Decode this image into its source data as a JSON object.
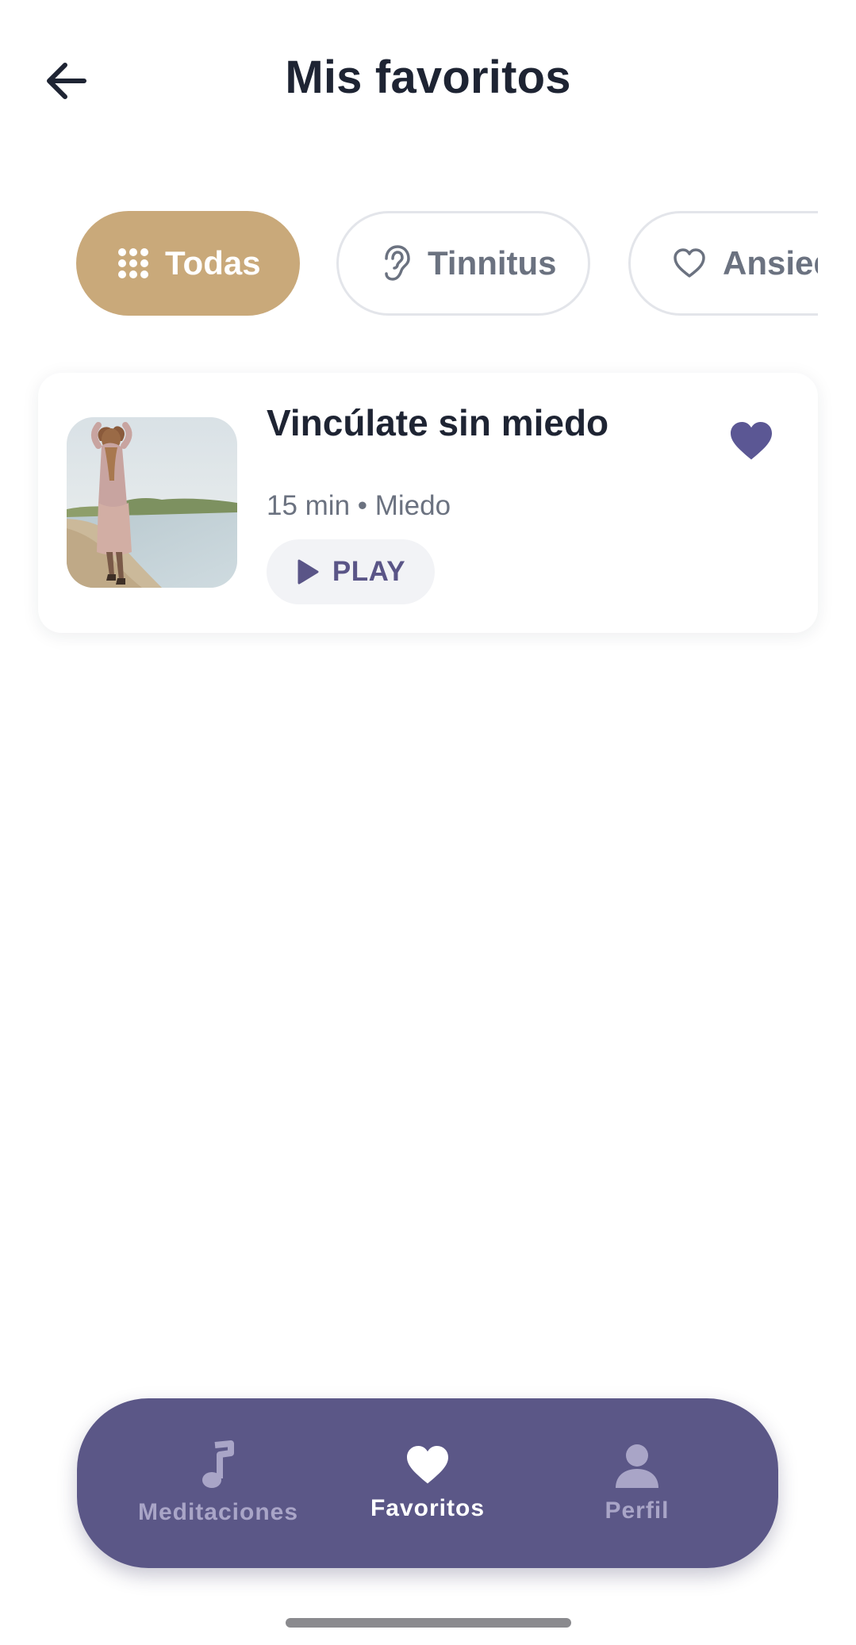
{
  "header": {
    "title": "Mis favoritos",
    "back_icon": "arrow-left-icon"
  },
  "filters": [
    {
      "label": "Todas",
      "icon": "grid-dots-icon",
      "active": true
    },
    {
      "label": "Tinnitus",
      "icon": "ear-icon",
      "active": false
    },
    {
      "label": "Ansiedad",
      "icon": "heart-outline-icon",
      "active": false
    }
  ],
  "favorites": [
    {
      "title": "Vincúlate sin miedo",
      "meta": "15 min • Miedo",
      "play_label": "PLAY",
      "favorited": true,
      "thumbnail_icon": "woman-at-lakeshore-image"
    }
  ],
  "bottom_nav": {
    "items": [
      {
        "label": "Meditaciones",
        "icon": "music-note-icon",
        "active": false
      },
      {
        "label": "Favoritos",
        "icon": "heart-icon",
        "active": true
      },
      {
        "label": "Perfil",
        "icon": "person-icon",
        "active": false
      }
    ]
  },
  "colors": {
    "accent_gold": "#c9a97a",
    "brand_purple": "#5b5787",
    "text_dark": "#1e2433",
    "text_muted": "#6b7280"
  }
}
